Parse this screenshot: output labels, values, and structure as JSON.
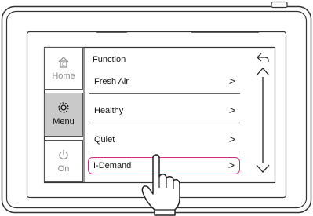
{
  "sidebar": {
    "items": [
      {
        "label": "Home",
        "icon": "home-icon",
        "active": false
      },
      {
        "label": "Menu",
        "icon": "gear-icon",
        "active": true
      },
      {
        "label": "On",
        "icon": "power-icon",
        "active": false
      }
    ]
  },
  "main": {
    "title": "Function",
    "items": [
      {
        "label": "Fresh Air",
        "arrow": ">"
      },
      {
        "label": "Healthy",
        "arrow": ">"
      },
      {
        "label": "Quiet",
        "arrow": ">"
      },
      {
        "label": "I-Demand",
        "arrow": ">",
        "selected": true
      }
    ]
  },
  "colors": {
    "highlight": "#d12a7a",
    "active_bg": "#c9c9c9",
    "frame": "#333333"
  }
}
